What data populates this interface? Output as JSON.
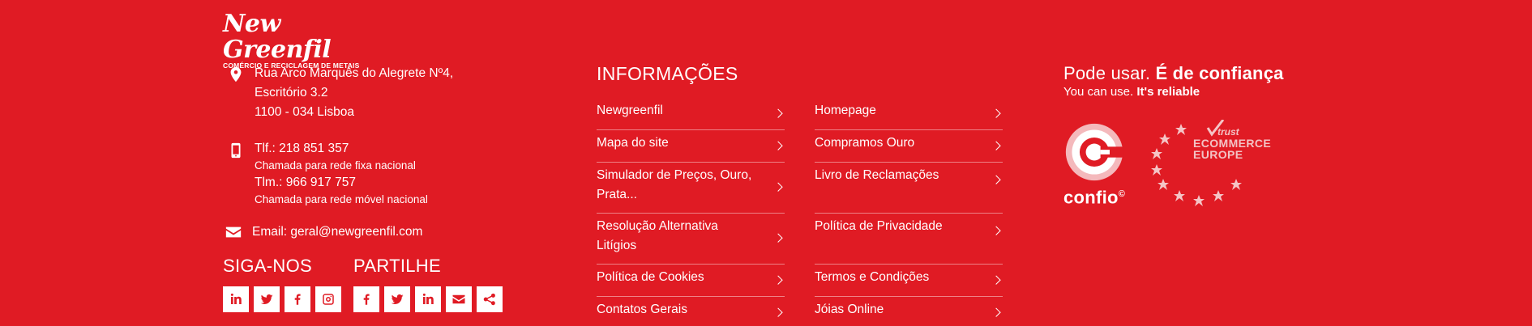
{
  "logo": {
    "name": "New Greenfil",
    "tagline": "COMÉRCIO E RECICLAGEM DE METAIS"
  },
  "contact": {
    "address": [
      "Rua Arco Marquês do Alegrete Nº4,",
      "Escritório 3.2",
      "1100 - 034 Lisboa"
    ],
    "phone_fixed": "Tlf.: 218 851 357",
    "phone_fixed_note": "Chamada para rede fixa nacional",
    "phone_mobile": "Tlm.: 966 917 757",
    "phone_mobile_note": "Chamada para rede móvel nacional",
    "email": "Email: geral@newgreenfil.com",
    "icons": [
      "location-pin-icon",
      "mobile-phone-icon",
      "envelope-icon"
    ]
  },
  "follow": {
    "title": "SIGA-NOS",
    "icons": [
      "linkedin-icon",
      "twitter-icon",
      "facebook-icon",
      "instagram-icon"
    ]
  },
  "share": {
    "title": "PARTILHE",
    "icons": [
      "facebook-icon",
      "twitter-icon",
      "linkedin-icon",
      "envelope-icon",
      "share-icon"
    ]
  },
  "info": {
    "title": "INFORMAÇÕES",
    "col1": [
      "Newgreenfil",
      "Mapa do site",
      "Simulador de Preços, Ouro, Prata...",
      "Resolução Alternativa Litígios",
      "Política de Cookies",
      "Contatos Gerais"
    ],
    "col2": [
      "Homepage",
      "Compramos Ouro",
      "Livro de Reclamações",
      "Política de Privacidade",
      "Termos e Condições",
      "Jóias Online"
    ]
  },
  "trust": {
    "title_prefix": "Pode usar.",
    "title_bold": "É de confiança",
    "sub_prefix": "You can use.",
    "sub_bold": "It's reliable",
    "confio_label": "confio",
    "confio_mark": "©",
    "tee_line1": "trust",
    "tee_line2": "ECOMMERCE",
    "tee_line3": "EUROPE"
  },
  "colors": {
    "background": "#E01B24",
    "foreground": "#FFFFFF"
  }
}
